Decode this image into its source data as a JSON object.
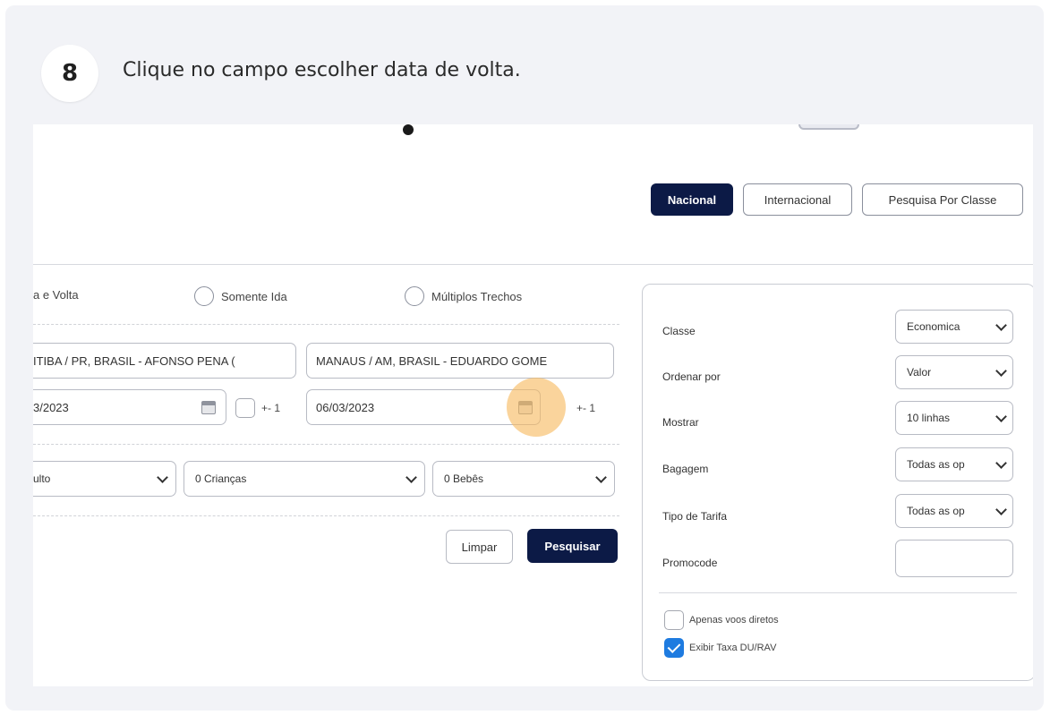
{
  "step": {
    "number": "8",
    "instruction": "Clique no campo escolher data de volta."
  },
  "tabs": {
    "nacional": "Nacional",
    "internacional": "Internacional",
    "classe": "Pesquisa Por Classe"
  },
  "trip_type": {
    "ida_volta": "a e Volta",
    "somente_ida": "Somente Ida",
    "multiplos": "Múltiplos Trechos"
  },
  "route": {
    "origin": "ITIBA / PR, BRASIL  - AFONSO PENA (",
    "destination": "MANAUS / AM, BRASIL  - EDUARDO GOME"
  },
  "dates": {
    "departure": "3/2023",
    "departure_flex": "+- 1",
    "return": "06/03/2023",
    "return_flex": "+- 1"
  },
  "passengers": {
    "adults": "ulto",
    "children": "0 Crianças",
    "infants": "0 Bebês"
  },
  "actions": {
    "clear": "Limpar",
    "search": "Pesquisar"
  },
  "filters": {
    "classe_label": "Classe",
    "classe_value": "Economica",
    "ordenar_label": "Ordenar por",
    "ordenar_value": "Valor",
    "mostrar_label": "Mostrar",
    "mostrar_value": "10 linhas",
    "bagagem_label": "Bagagem",
    "bagagem_value": "Todas as op",
    "tarifa_label": "Tipo de Tarifa",
    "tarifa_value": "Todas as op",
    "promocode_label": "Promocode",
    "promocode_value": "",
    "diretos_label": "Apenas voos diretos",
    "diretos_checked": false,
    "taxa_label": "Exibir Taxa DU/RAV",
    "taxa_checked": true
  },
  "colors": {
    "primary_dark": "#0c1a46",
    "highlight": "#f7ba60",
    "checkbox_blue": "#1e7be0"
  }
}
